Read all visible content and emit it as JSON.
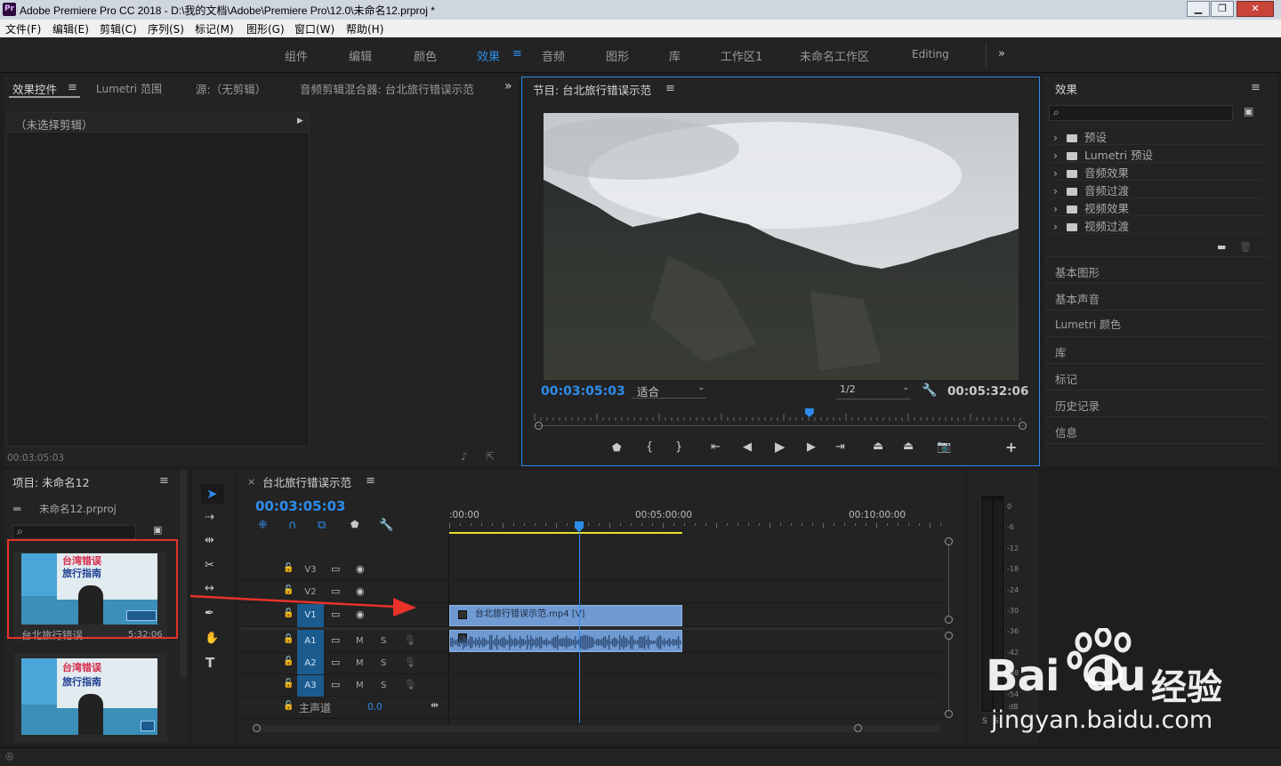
{
  "window": {
    "title": "Adobe Premiere Pro CC 2018 - D:\\我的文档\\Adobe\\Premiere Pro\\12.0\\未命名12.prproj *",
    "logo_text": "Pr"
  },
  "menu": [
    "文件(F)",
    "编辑(E)",
    "剪辑(C)",
    "序列(S)",
    "标记(M)",
    "图形(G)",
    "窗口(W)",
    "帮助(H)"
  ],
  "workspaces": [
    {
      "label": "组件",
      "active": false
    },
    {
      "label": "编辑",
      "active": false
    },
    {
      "label": "颜色",
      "active": false
    },
    {
      "label": "效果",
      "active": true
    },
    {
      "label": "音频",
      "active": false
    },
    {
      "label": "图形",
      "active": false
    },
    {
      "label": "库",
      "active": false
    },
    {
      "label": "工作区1",
      "active": false
    },
    {
      "label": "未命名工作区",
      "active": false
    },
    {
      "label": "Editing",
      "active": false
    }
  ],
  "source_panel": {
    "tabs": [
      "效果控件",
      "Lumetri 范围",
      "源:（无剪辑）",
      "音频剪辑混合器: 台北旅行错误示范"
    ],
    "no_clip": "（未选择剪辑）",
    "timecode": "00:03:05:03"
  },
  "program": {
    "title": "节目: 台北旅行错误示范",
    "timecode_current": "00:03:05:03",
    "fit": "适合",
    "resolution": "1/2",
    "timecode_duration": "00:05:32:06",
    "playhead_fraction": 0.56
  },
  "project": {
    "title": "项目: 未命名12",
    "file": "未命名12.prproj",
    "items": [
      {
        "name": "台北旅行错误...",
        "duration": "5:32:06",
        "thumb_line1": "台湾错误",
        "thumb_line2": "旅行指南"
      },
      {
        "name": "",
        "duration": "",
        "thumb_line1": "台湾错误",
        "thumb_line2": "旅行指南"
      }
    ]
  },
  "timeline": {
    "title": "台北旅行错误示范",
    "timecode": "00:03:05:03",
    "ruler": [
      ":00:00",
      "00:05:00:00",
      "00:10:00:00"
    ],
    "video_tracks": [
      "V3",
      "V2",
      "V1"
    ],
    "audio_tracks": [
      "A1",
      "A2",
      "A3"
    ],
    "master": {
      "label": "主声道",
      "value": "0.0"
    },
    "clip_label": "台北旅行错误示范.mp4 [V]",
    "mute": "M",
    "solo": "S"
  },
  "meter": {
    "scale": [
      "0",
      "-6",
      "-12",
      "-18",
      "-24",
      "-30",
      "-36",
      "-42",
      "-48",
      "-54"
    ],
    "unit": "dB",
    "solo_labels": [
      "S",
      "S"
    ]
  },
  "effects": {
    "title": "效果",
    "items": [
      "预设",
      "Lumetri 预设",
      "音频效果",
      "音频过渡",
      "视频效果",
      "视频过渡"
    ],
    "sections": [
      "基本图形",
      "基本声音",
      "Lumetri 颜色",
      "库",
      "标记",
      "历史记录",
      "信息"
    ]
  },
  "watermark": {
    "brand": "Bai",
    "brand2": "du",
    "cn": "经验",
    "url": "jingyan.baidu.com"
  },
  "colors": {
    "accent": "#2d8ceb",
    "annotation": "#e8322a",
    "clip": "#6f9ad2"
  }
}
